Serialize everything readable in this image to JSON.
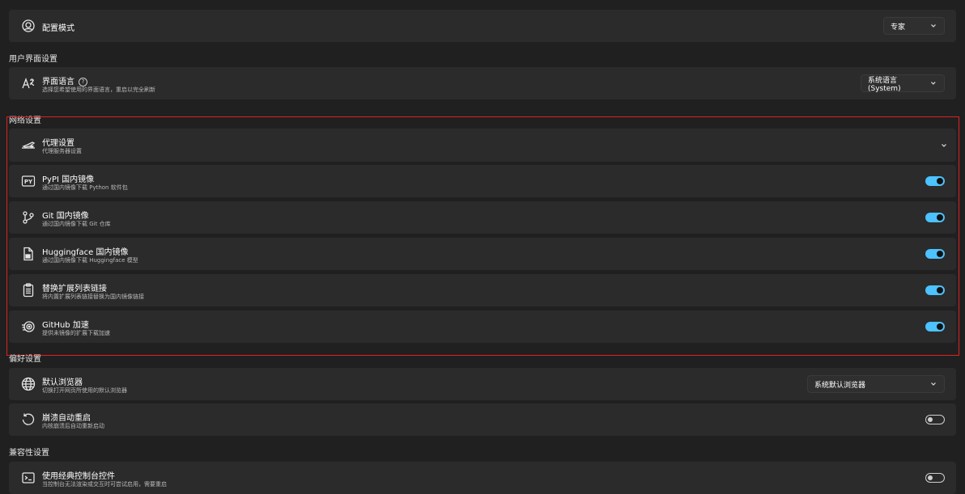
{
  "config_mode": {
    "label": "配置模式",
    "value": "专家"
  },
  "ui_section": {
    "header": "用户界面设置",
    "language": {
      "title": "界面语言",
      "desc": "选择您希望使用的界面语言，重启以完全刷新",
      "value": "系统语言 (System)"
    }
  },
  "network_section": {
    "header": "网络设置",
    "proxy": {
      "title": "代理设置",
      "desc": "代理服务器设置"
    },
    "items": [
      {
        "title": "PyPI 国内镜像",
        "desc": "通过国内镜像下载 Python 软件包",
        "enabled": true,
        "icon": "pypi-icon"
      },
      {
        "title": "Git 国内镜像",
        "desc": "通过国内镜像下载 Git 仓库",
        "enabled": true,
        "icon": "git-branch-icon"
      },
      {
        "title": "Huggingface 国内镜像",
        "desc": "通过国内镜像下载 Huggingface 模型",
        "enabled": true,
        "icon": "model-file-icon"
      },
      {
        "title": "替换扩展列表链接",
        "desc": "将内置扩展列表链接替换为国内镜像链接",
        "enabled": true,
        "icon": "clipboard-list-icon"
      },
      {
        "title": "GitHub 加速",
        "desc": "提供未镜像的扩展下载加速",
        "enabled": true,
        "icon": "speed-icon"
      }
    ]
  },
  "preference_section": {
    "header": "偏好设置",
    "browser": {
      "title": "默认浏览器",
      "desc": "切换打开网页所使用的默认浏览器",
      "value": "系统默认浏览器"
    },
    "auto_restart": {
      "title": "崩溃自动重启",
      "desc": "内核崩溃后自动重新启动",
      "enabled": false
    }
  },
  "compat_section": {
    "header": "兼容性设置",
    "classic_console": {
      "title": "使用经典控制台控件",
      "desc": "当控制台无法渲染或交互时可尝试启用，需要重启",
      "enabled": false
    }
  },
  "colors": {
    "accent": "#4cc2ff",
    "highlight": "#e02020"
  }
}
